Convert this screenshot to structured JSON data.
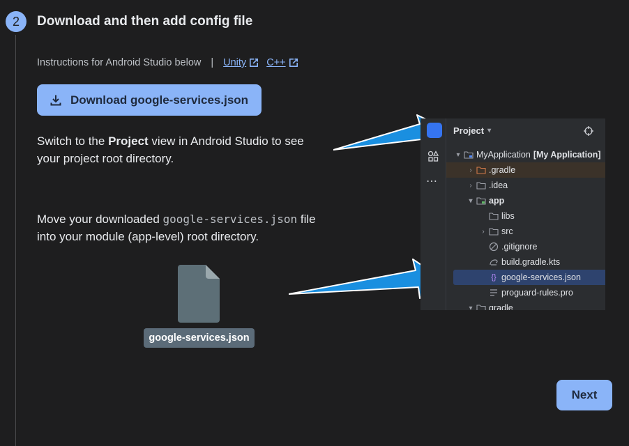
{
  "step": {
    "number": "2",
    "title": "Download and then add config file"
  },
  "instructions": {
    "text": "Instructions for Android Studio below",
    "separator": "|",
    "links": [
      {
        "label": "Unity"
      },
      {
        "label": "C++"
      }
    ]
  },
  "download_button": {
    "label": "Download google-services.json"
  },
  "paragraph1": {
    "prefix": "Switch to the ",
    "bold": "Project",
    "suffix": " view in Android Studio to see your project root directory."
  },
  "paragraph2": {
    "prefix": "Move your downloaded ",
    "code": "google-services.json",
    "suffix": " file into your module (app-level) root directory."
  },
  "file_tile": {
    "label": "google-services.json"
  },
  "studio": {
    "header": "Project",
    "tree": [
      {
        "name": "MyApplication",
        "extra": "[My Application]"
      },
      {
        "name": ".gradle"
      },
      {
        "name": ".idea"
      },
      {
        "name": "app"
      },
      {
        "name": "libs"
      },
      {
        "name": "src"
      },
      {
        "name": ".gitignore"
      },
      {
        "name": "build.gradle.kts"
      },
      {
        "name": "google-services.json"
      },
      {
        "name": "proguard-rules.pro"
      },
      {
        "name": "gradle"
      }
    ]
  },
  "next_button": {
    "label": "Next"
  },
  "colors": {
    "background": "#1e1e1f",
    "accent": "#8ab4f8",
    "arrow": "#1a8fe0",
    "studio_bg": "#2b2d30",
    "selected_row": "#2e436e"
  },
  "icons": [
    "download-icon",
    "external-link-icon",
    "file-icon",
    "arrow-right-icon",
    "folder-icon",
    "chevron-down-icon",
    "target-icon"
  ]
}
